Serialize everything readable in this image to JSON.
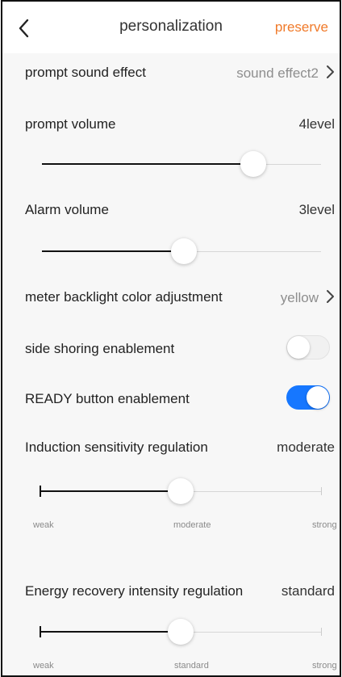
{
  "header": {
    "title": "personalization",
    "save_label": "preserve",
    "accent_color": "#f07a2a"
  },
  "settings": {
    "prompt_sound_effect": {
      "label": "prompt sound effect",
      "value": "sound effect2"
    },
    "prompt_volume": {
      "label": "prompt volume",
      "value": "4level",
      "fill": 0.76
    },
    "alarm_volume": {
      "label": "Alarm volume",
      "value": "3level",
      "fill": 0.5
    },
    "backlight_color": {
      "label": "meter backlight color adjustment",
      "value": "yellow"
    },
    "side_shoring": {
      "label": "side shoring enablement",
      "enabled": false
    },
    "ready_button": {
      "label": "READY button enablement",
      "enabled": true,
      "color": "#1677ff"
    },
    "induction_sensitivity": {
      "label": "Induction sensitivity regulation",
      "value": "moderate",
      "ticks": [
        "weak",
        "moderate",
        "strong"
      ],
      "fill": 0.5
    },
    "energy_recovery": {
      "label": "Energy recovery intensity regulation",
      "value": "standard",
      "ticks": [
        "weak",
        "standard",
        "strong"
      ],
      "fill": 0.5
    }
  }
}
